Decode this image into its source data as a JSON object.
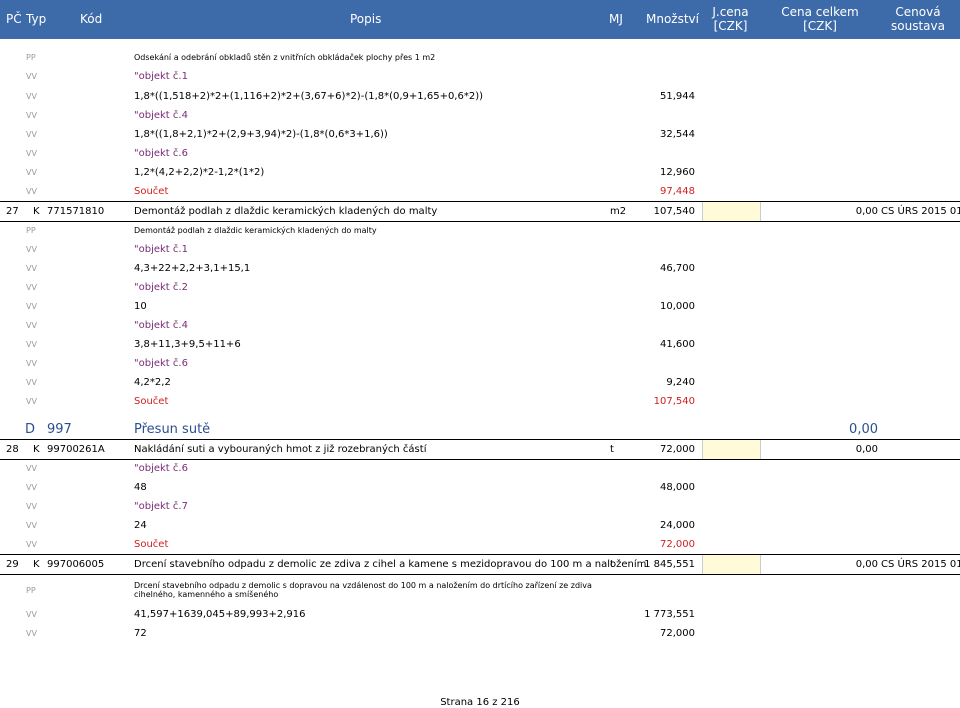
{
  "header": {
    "pc": "PČ",
    "typ": "Typ",
    "kod": "Kód",
    "popis": "Popis",
    "mj": "MJ",
    "mnozstvi": "Množství",
    "jcena1": "J.cena",
    "jcena2": "[CZK]",
    "celkem1": "Cena celkem",
    "celkem2": "[CZK]",
    "soustava1": "Cenová",
    "soustava2": "soustava"
  },
  "rows": [
    {
      "type": "PP",
      "desc": "Odsekání a odebrání obkladů stěn z vnitřních obkládaček plochy přes 1 m2",
      "qty": ""
    },
    {
      "type": "VV",
      "desc": "\"objekt č.1",
      "qty": ""
    },
    {
      "type": "VV",
      "desc": "1,8*((1,518+2)*2+(1,116+2)*2+(3,67+6)*2)-(1,8*(0,9+1,65+0,6*2))",
      "qty": "51,944"
    },
    {
      "type": "VV",
      "desc": "\"objekt č.4",
      "qty": ""
    },
    {
      "type": "VV",
      "desc": "1,8*((1,8+2,1)*2+(2,9+3,94)*2)-(1,8*(0,6*3+1,6))",
      "qty": "32,544"
    },
    {
      "type": "VV",
      "desc": "\"objekt č.6",
      "qty": ""
    },
    {
      "type": "VV",
      "desc": "1,2*(4,2+2,2)*2-1,2*(1*2)",
      "qty": "12,960"
    },
    {
      "type": "VV",
      "desc": "Součet",
      "qty": "97,448"
    },
    {
      "pc": "27",
      "type": "K",
      "code": "771571810",
      "desc": "Demontáž podlah z dlaždic keramických kladených do malty",
      "mj": "m2",
      "qty": "107,540",
      "total": "0,00",
      "sys": "CS ÚRS 2015 01"
    },
    {
      "type": "PP",
      "desc": "Demontáž podlah z dlaždic keramických kladených do malty",
      "qty": ""
    },
    {
      "type": "VV",
      "desc": "\"objekt č.1",
      "qty": ""
    },
    {
      "type": "VV",
      "desc": "4,3+22+2,2+3,1+15,1",
      "qty": "46,700"
    },
    {
      "type": "VV",
      "desc": "\"objekt č.2",
      "qty": ""
    },
    {
      "type": "VV",
      "desc": "10",
      "qty": "10,000"
    },
    {
      "type": "VV",
      "desc": "\"objekt č.4",
      "qty": ""
    },
    {
      "type": "VV",
      "desc": "3,8+11,3+9,5+11+6",
      "qty": "41,600"
    },
    {
      "type": "VV",
      "desc": "\"objekt č.6",
      "qty": ""
    },
    {
      "type": "VV",
      "desc": "4,2*2,2",
      "qty": "9,240"
    },
    {
      "type": "VV",
      "desc": "Součet",
      "qty": "107,540"
    },
    {
      "type": "D",
      "code": "997",
      "desc": "Přesun sutě",
      "total": "0,00"
    },
    {
      "pc": "28",
      "type": "K",
      "code": "99700261A",
      "desc": "Nakládání suti a vybouraných hmot z již rozebraných částí",
      "mj": "t",
      "qty": "72,000",
      "total": "0,00",
      "sys": ""
    },
    {
      "type": "VV",
      "desc": "\"objekt č.6",
      "qty": ""
    },
    {
      "type": "VV",
      "desc": "48",
      "qty": "48,000"
    },
    {
      "type": "VV",
      "desc": "\"objekt č.7",
      "qty": ""
    },
    {
      "type": "VV",
      "desc": "24",
      "qty": "24,000"
    },
    {
      "type": "VV",
      "desc": "Součet",
      "qty": "72,000"
    },
    {
      "pc": "29",
      "type": "K",
      "code": "997006005",
      "desc": "Drcení stavebního odpadu z demolic ze zdiva z cihel a kamene s mezidopravou do 100 m a naložením",
      "mj": "t",
      "qty": "1 845,551",
      "total": "0,00",
      "sys": "CS ÚRS 2015 01"
    },
    {
      "type": "PP",
      "desc": "Drcení stavebního odpadu z demolic s dopravou na vzdálenost do 100 m a naložením do drtícího zařízení ze zdiva",
      "desc2": "cihelného, kamenného a smíšeného",
      "qty": ""
    },
    {
      "type": "VV",
      "desc": "41,597+1639,045+89,993+2,916",
      "qty": "1 773,551"
    },
    {
      "type": "VV",
      "desc": "72",
      "qty": "72,000"
    }
  ],
  "footer": "Strana 16 z 216"
}
